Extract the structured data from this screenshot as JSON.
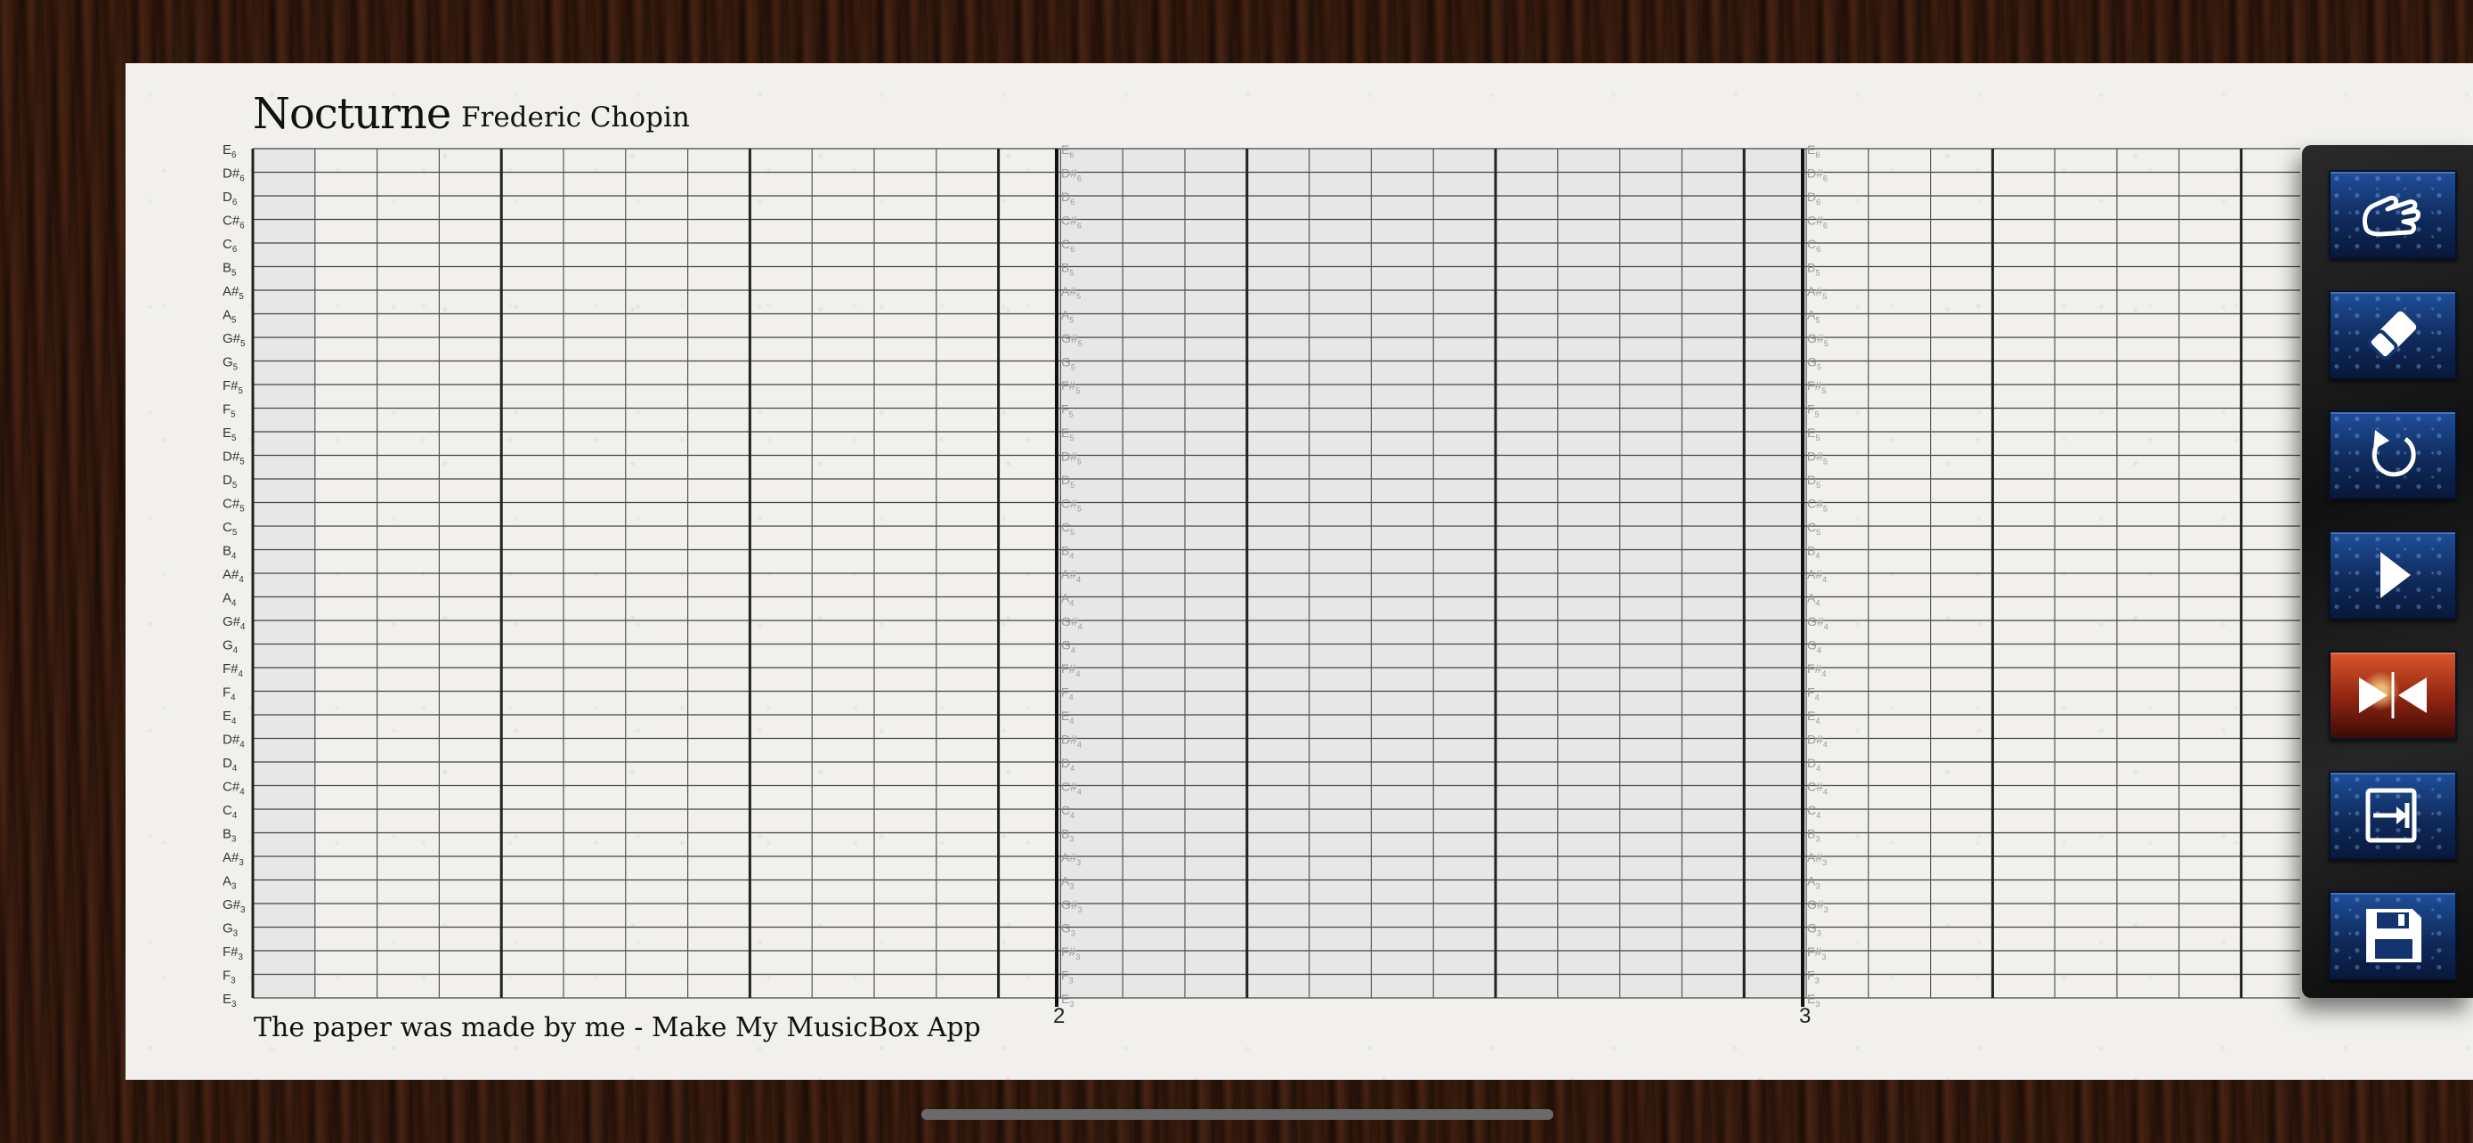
{
  "song": {
    "title": "Nocturne",
    "composer": "Frederic Chopin"
  },
  "footer_text": "The paper was made by me - Make My MusicBox App",
  "notes": [
    "E6",
    "D#6",
    "D6",
    "C#6",
    "C6",
    "B5",
    "A#5",
    "A5",
    "G#5",
    "G5",
    "F#5",
    "F5",
    "E5",
    "D#5",
    "D5",
    "C#5",
    "C5",
    "B4",
    "A#4",
    "A4",
    "G#4",
    "G4",
    "F#4",
    "F4",
    "E4",
    "D#4",
    "D4",
    "C#4",
    "C4",
    "B3",
    "A#3",
    "A3",
    "G#3",
    "G3",
    "F#3",
    "F3",
    "E3"
  ],
  "measure_numbers": [
    "2",
    "3"
  ],
  "toolbar": {
    "tools": [
      {
        "name": "hand-tool-button",
        "icon": "hand-icon",
        "active": false
      },
      {
        "name": "eraser-tool-button",
        "icon": "eraser-icon",
        "active": false
      },
      {
        "name": "undo-button",
        "icon": "undo-icon",
        "active": false
      },
      {
        "name": "play-button",
        "icon": "play-icon",
        "active": false
      },
      {
        "name": "compress-button",
        "icon": "compress-icon",
        "active": true
      },
      {
        "name": "export-button",
        "icon": "export-icon",
        "active": false
      },
      {
        "name": "save-button",
        "icon": "save-icon",
        "active": false
      }
    ]
  },
  "colors": {
    "paper": "#f1f0ec",
    "shaded_column": "#e7e7e7",
    "grid_line": "#444444",
    "toolbar_button": "#13346e",
    "active_button": "#b9401d"
  }
}
